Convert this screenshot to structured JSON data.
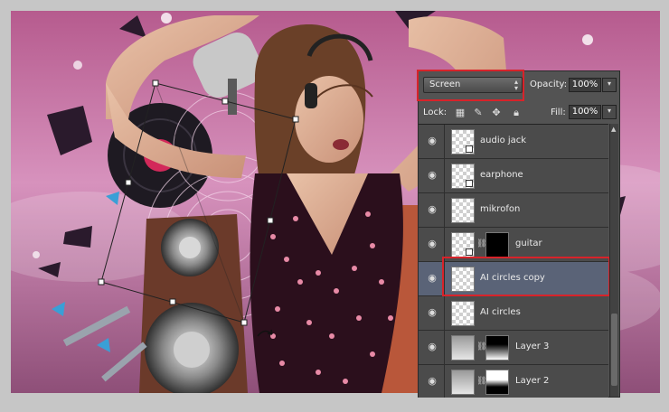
{
  "panel": {
    "blend_mode": "Screen",
    "opacity_label": "Opacity:",
    "opacity_value": "100%",
    "lock_label": "Lock:",
    "fill_label": "Fill:",
    "fill_value": "100%"
  },
  "layers": [
    {
      "name": "audio jack",
      "thumb": "checker",
      "smart": true,
      "mask": false,
      "selected": false
    },
    {
      "name": "earphone",
      "thumb": "checker",
      "smart": true,
      "mask": false,
      "selected": false
    },
    {
      "name": "mikrofon",
      "thumb": "checker",
      "smart": false,
      "mask": false,
      "selected": false
    },
    {
      "name": "guitar",
      "thumb": "checker",
      "smart": true,
      "mask": true,
      "selected": false
    },
    {
      "name": "AI circles copy",
      "thumb": "checker",
      "smart": false,
      "mask": false,
      "selected": true
    },
    {
      "name": "AI circles",
      "thumb": "checker",
      "smart": false,
      "mask": false,
      "selected": false
    },
    {
      "name": "Layer 3",
      "thumb": "gradient",
      "smart": false,
      "mask": true,
      "selected": false
    },
    {
      "name": "Layer 2",
      "thumb": "gradient",
      "smart": false,
      "mask": true,
      "selected": false
    }
  ],
  "colors": {
    "highlight_outline": "#d8232a",
    "panel_bg": "#535353",
    "selected_row": "#5a6377"
  },
  "icons": [
    "eye-icon",
    "lock-transparent-icon",
    "lock-brush-icon",
    "lock-move-icon",
    "lock-all-icon",
    "chain-link-icon",
    "transform-handle-icon"
  ]
}
